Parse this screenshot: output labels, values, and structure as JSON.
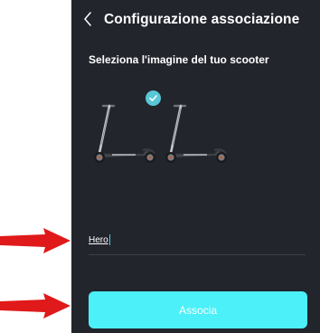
{
  "header": {
    "title": "Configurazione associazione",
    "back_icon": "chevron-left-icon"
  },
  "selection": {
    "prompt": "Seleziona l'imagine del tuo scooter",
    "selected_index": 0,
    "options": [
      {
        "icon": "kick-scooter-icon",
        "selected": true
      },
      {
        "icon": "kick-scooter-icon",
        "selected": false
      }
    ]
  },
  "name_input": {
    "value": "Hero"
  },
  "primary_button": {
    "label": "Associa"
  },
  "annotations": {
    "arrow_color": "#e0191a",
    "count": 2
  },
  "colors": {
    "background": "#23252d",
    "accent": "#4cf0f8",
    "check": "#58c7d8"
  }
}
